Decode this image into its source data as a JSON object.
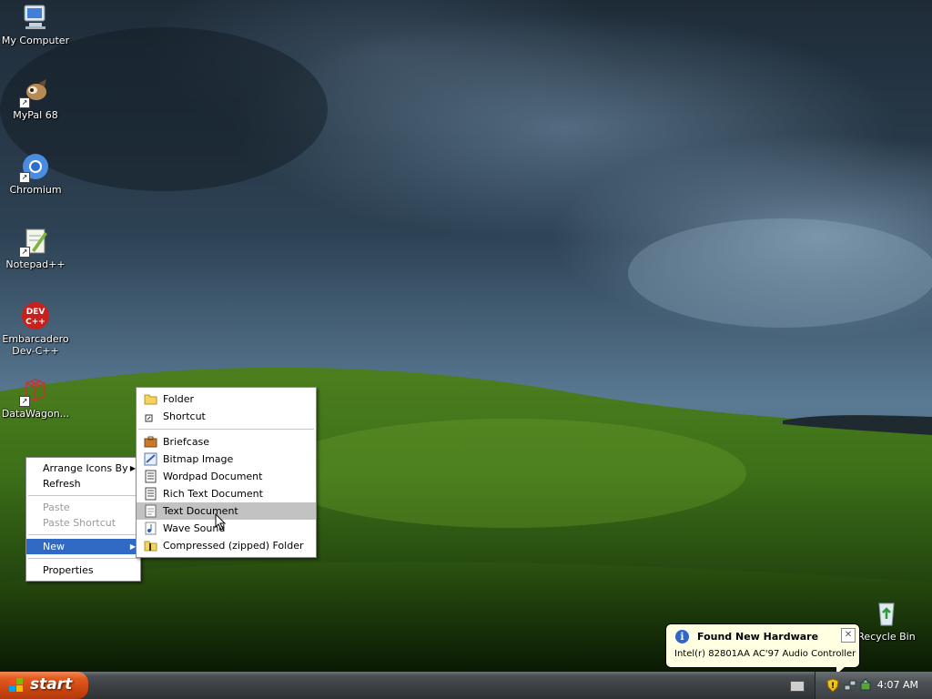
{
  "desktop": {
    "icons": [
      {
        "label": "My Computer",
        "icon": "computer-icon"
      },
      {
        "label": "MyPal 68",
        "icon": "mypal-browser-icon"
      },
      {
        "label": "Chromium",
        "icon": "chromium-icon"
      },
      {
        "label": "Notepad++",
        "icon": "notepad-plus-plus-icon"
      },
      {
        "label": "Embarcadero\nDev-C++",
        "icon": "devcpp-icon"
      },
      {
        "label": "DataWagon...",
        "icon": "datawagon-icon"
      }
    ],
    "recycle_bin": {
      "label": "Recycle Bin",
      "icon": "recycle-bin-icon"
    }
  },
  "context_menu": {
    "arrange": "Arrange Icons By",
    "refresh": "Refresh",
    "paste": "Paste",
    "paste_shortcut": "Paste Shortcut",
    "new": "New",
    "properties": "Properties"
  },
  "new_submenu": {
    "items": [
      {
        "label": "Folder",
        "icon": "folder-icon"
      },
      {
        "label": "Shortcut",
        "icon": "shortcut-icon"
      },
      {
        "label": "Briefcase",
        "icon": "briefcase-icon"
      },
      {
        "label": "Bitmap Image",
        "icon": "bitmap-icon"
      },
      {
        "label": "Wordpad Document",
        "icon": "wordpad-icon"
      },
      {
        "label": "Rich Text Document",
        "icon": "rich-text-icon"
      },
      {
        "label": "Text Document",
        "icon": "text-document-icon",
        "highlighted": true
      },
      {
        "label": "Wave Sound",
        "icon": "wave-sound-icon"
      },
      {
        "label": "Compressed (zipped) Folder",
        "icon": "zip-folder-icon"
      }
    ]
  },
  "balloon": {
    "title": "Found New Hardware",
    "message": "Intel(r) 82801AA AC'97 Audio Controller",
    "close": "✕",
    "info": "i"
  },
  "taskbar": {
    "start_label": "start",
    "clock": "4:07 AM"
  },
  "colors": {
    "menu_selection": "#316ac5",
    "submenu_hover": "#c2c2c2",
    "start_button": "#e25a1f",
    "balloon_bg": "#ffffe1"
  }
}
